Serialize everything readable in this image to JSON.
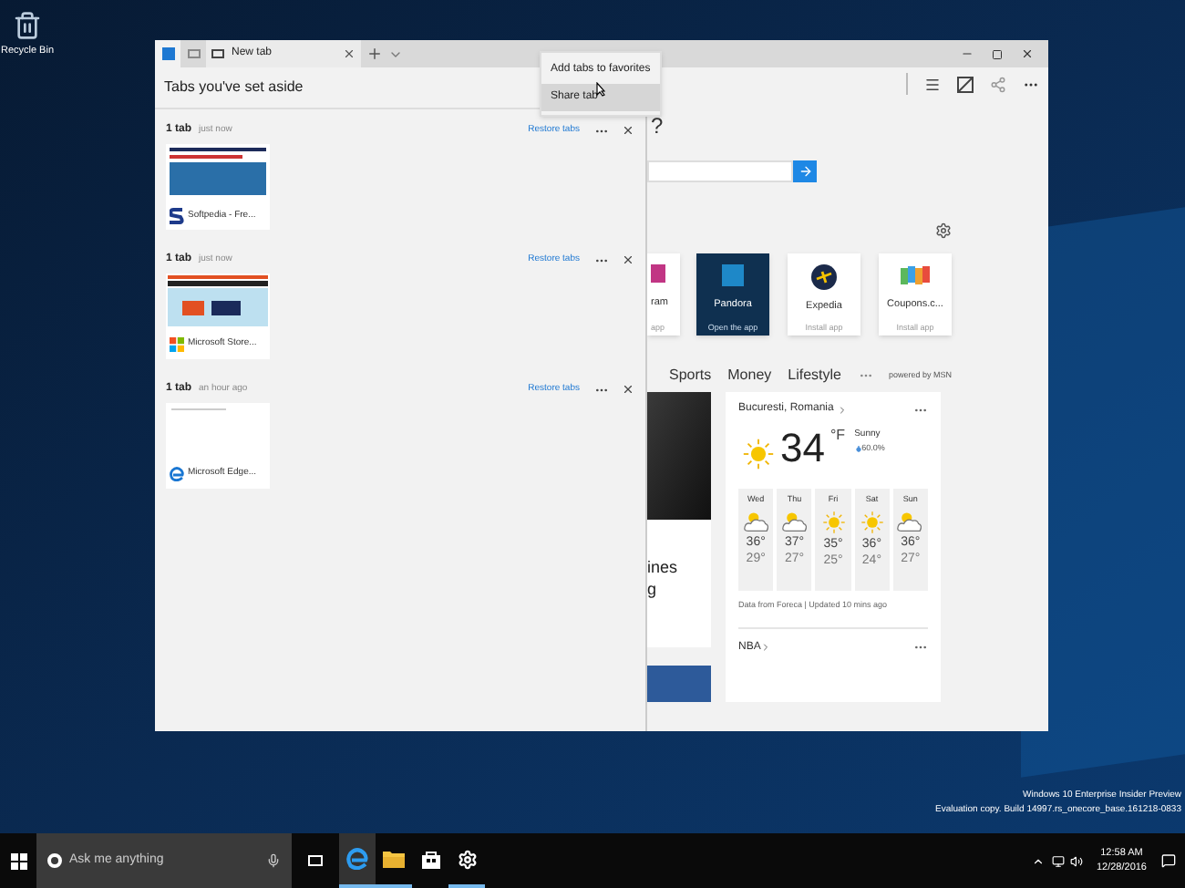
{
  "desktop": {
    "icons": [
      {
        "label": "Recycle Bin"
      }
    ]
  },
  "browser": {
    "tabs": [
      {
        "label": "New tab",
        "selected": true
      }
    ],
    "menu": {
      "items": [
        {
          "label": "Add tabs to favorites",
          "selected": false
        },
        {
          "label": "Share tab",
          "selected": true
        }
      ]
    },
    "aside_panel": {
      "title": "Tabs you've set aside",
      "groups": [
        {
          "count": "1 tab",
          "time": "just now",
          "restore": "Restore tabs",
          "tabs": [
            {
              "title": "Softpedia - Fre...",
              "kind": "blue-page"
            }
          ]
        },
        {
          "count": "1 tab",
          "time": "just now",
          "restore": "Restore tabs",
          "tabs": [
            {
              "title": "Microsoft Store...",
              "kind": "orange-page"
            }
          ]
        },
        {
          "count": "1 tab",
          "time": "an hour ago",
          "restore": "Restore tabs",
          "tabs": [
            {
              "title": "Microsoft Edge...",
              "kind": "blank-page"
            }
          ]
        }
      ]
    },
    "new_tab_page": {
      "heading": "?",
      "top_sites": [
        {
          "name": "ram",
          "caption": "app",
          "kind": "pink",
          "selected": false
        },
        {
          "name": "Pandora",
          "caption": "Open the app",
          "kind": "letter",
          "selected": true
        },
        {
          "name": "Expedia",
          "caption": "Install app",
          "kind": "plane",
          "selected": false
        },
        {
          "name": "Coupons.c...",
          "caption": "Install app",
          "kind": "tags",
          "selected": false
        }
      ],
      "news_tabs": [
        {
          "label": "Sports"
        },
        {
          "label": "Money"
        },
        {
          "label": "Lifestyle"
        }
      ],
      "powered_by": "powered by MSN",
      "headline": [
        "ines",
        "g"
      ],
      "weather": {
        "location": "Bucuresti, Romania",
        "temp": "34",
        "unit": "°F",
        "condition": "Sunny",
        "precip": "60.0%",
        "days": [
          {
            "day": "Wed",
            "kind": "partly",
            "high": "36°",
            "low": "29°"
          },
          {
            "day": "Thu",
            "kind": "partly",
            "high": "37°",
            "low": "27°"
          },
          {
            "day": "Fri",
            "kind": "sunny",
            "high": "35°",
            "low": "25°"
          },
          {
            "day": "Sat",
            "kind": "sunny",
            "high": "36°",
            "low": "24°"
          },
          {
            "day": "Sun",
            "kind": "partly",
            "high": "36°",
            "low": "27°"
          }
        ],
        "source": "Data from Foreca | Updated 10 mins ago",
        "next": "NBA"
      }
    }
  },
  "os_notice": [
    "Windows 10 Enterprise Insider Preview",
    "Evaluation copy. Build 14997.rs_onecore_base.161218-0833"
  ],
  "taskbar": {
    "search_placeholder": "Ask me anything",
    "apps": [
      {
        "kind": "edge",
        "selected": true,
        "running": true
      },
      {
        "kind": "folder",
        "selected": false,
        "running": true
      },
      {
        "kind": "store",
        "selected": false,
        "running": false
      },
      {
        "kind": "gear",
        "selected": false,
        "running": true
      }
    ],
    "clock": {
      "time": "12:58 AM",
      "date": "12/28/2016"
    }
  }
}
